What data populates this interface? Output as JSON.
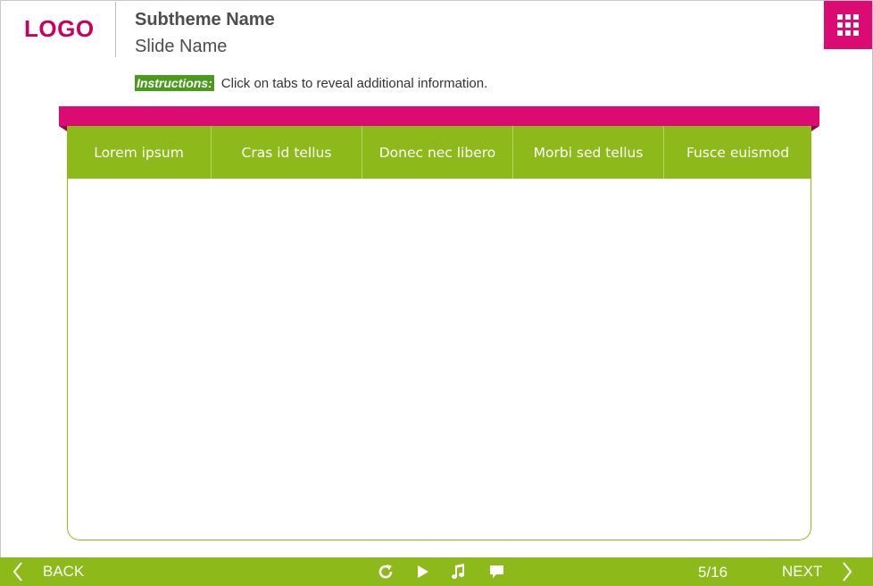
{
  "header": {
    "logo": "LOGO",
    "subtheme": "Subtheme Name",
    "slide_name": "Slide Name",
    "menu_icon": "grid-menu-icon"
  },
  "instructions": {
    "label": "Instructions:",
    "text": "Click on tabs to reveal additional information."
  },
  "tabs": [
    {
      "label": "Lorem ipsum"
    },
    {
      "label": "Cras id tellus"
    },
    {
      "label": "Donec nec libero"
    },
    {
      "label": "Morbi sed tellus"
    },
    {
      "label": "Fusce euismod"
    }
  ],
  "footer": {
    "back_label": "BACK",
    "next_label": "NEXT",
    "page": "5/16",
    "controls": [
      "replay-icon",
      "play-icon",
      "music-icon",
      "comment-icon"
    ]
  },
  "colors": {
    "accent_pink": "#dc0a73",
    "accent_green": "#8dba1a",
    "instruction_green": "#4b9a1e",
    "logo": "#c8005f"
  }
}
